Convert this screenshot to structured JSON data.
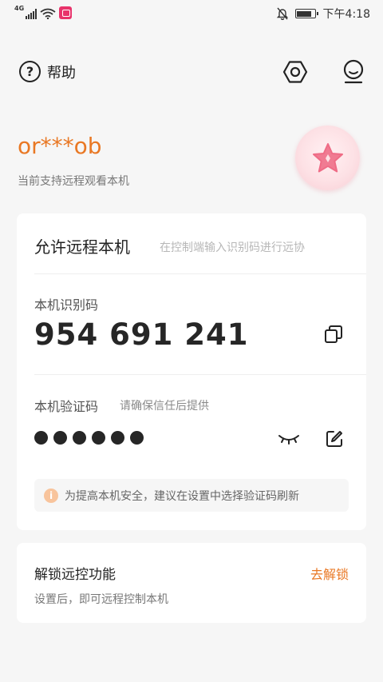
{
  "status_bar": {
    "network": "4G",
    "time": "下午4:18",
    "battery_level": 0.85
  },
  "header": {
    "help_label": "帮助",
    "help_glyph": "?",
    "icons": [
      "help-icon",
      "settings-hexagon-icon",
      "profile-icon"
    ]
  },
  "device": {
    "name": "or***ob",
    "subtitle": "当前支持远程观看本机"
  },
  "remote_card": {
    "title": "允许远程本机",
    "hint": "在控制端输入识别码进行远协",
    "id_label": "本机识别码",
    "id_code": "954 691 241",
    "verify_label": "本机验证码",
    "verify_hint": "请确保信任后提供",
    "password_dot_count": 6,
    "tip_icon": "i",
    "tip": "为提高本机安全，建议在设置中选择验证码刷新"
  },
  "unlock_card": {
    "title": "解锁远控功能",
    "action": "去解锁",
    "subtitle": "设置后，即可远程控制本机"
  },
  "colors": {
    "accent": "#e97824",
    "background": "#f6f6f6",
    "card": "#ffffff",
    "tip_icon": "#f8c49c",
    "avatar_star": "#f07b92"
  }
}
